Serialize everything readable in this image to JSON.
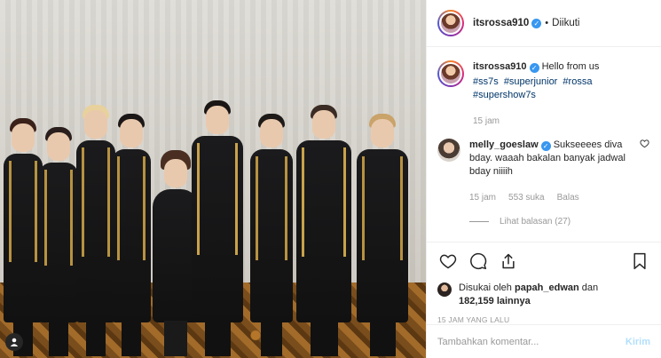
{
  "post": {
    "image_alt": "Group photo of nine people in black and gold jackets posing on a patterned carpet",
    "user_tag_icon": "user-tag-icon"
  },
  "header": {
    "username": "itsrossa910",
    "separator": "•",
    "follow_status": "Diikuti",
    "verified_icon": "verified-badge-icon"
  },
  "caption": {
    "username": "itsrossa910",
    "text": "Hello from us",
    "hashtags": [
      "#ss7s",
      "#superjunior",
      "#rossa",
      "#supershow7s"
    ],
    "time": "15 jam"
  },
  "comment": {
    "username": "melly_goeslaw",
    "text": "Sukseeees diva bday. waaah bakalan banyak jadwal bday niiiih",
    "time": "15 jam",
    "likes": "553 suka",
    "reply_label": "Balas",
    "view_replies": "Lihat balasan (27)"
  },
  "actions": {
    "like_icon": "heart-icon",
    "comment_icon": "comment-icon",
    "share_icon": "share-icon",
    "save_icon": "bookmark-icon"
  },
  "likes": {
    "prefix": "Disukai oleh",
    "user": "papah_edwan",
    "conjunction": "dan",
    "count": "182,159",
    "suffix": "lainnya"
  },
  "timestamp": "15 JAM YANG LALU",
  "comment_box": {
    "placeholder": "Tambahkan komentar...",
    "post_label": "Kirim"
  },
  "colors": {
    "link": "#003569",
    "verified": "#3897f0",
    "muted": "#999999",
    "post_disabled": "#b2dffc"
  }
}
